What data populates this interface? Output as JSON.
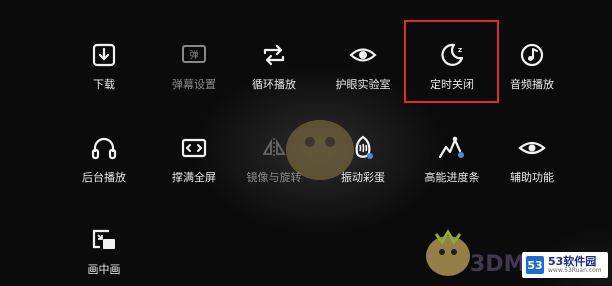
{
  "menu": {
    "items": [
      {
        "label": "下载",
        "icon": "download-icon",
        "disabled": false
      },
      {
        "label": "弹幕设置",
        "icon": "danmaku-settings-icon",
        "disabled": true
      },
      {
        "label": "循环播放",
        "icon": "loop-icon",
        "disabled": false
      },
      {
        "label": "护眼实验室",
        "icon": "eye-care-icon",
        "disabled": false
      },
      {
        "label": "定时关闭",
        "icon": "sleep-timer-icon",
        "disabled": false
      },
      {
        "label": "音频播放",
        "icon": "audio-disc-icon",
        "disabled": false
      },
      {
        "label": "后台播放",
        "icon": "headphones-icon",
        "disabled": false
      },
      {
        "label": "撑满全屏",
        "icon": "fill-screen-icon",
        "disabled": false
      },
      {
        "label": "镜像与旋转",
        "icon": "mirror-rotate-icon",
        "disabled": true
      },
      {
        "label": "振动彩蛋",
        "icon": "vibration-icon",
        "disabled": false
      },
      {
        "label": "高能进度条",
        "icon": "energy-progress-icon",
        "disabled": false
      },
      {
        "label": "辅助功能",
        "icon": "accessibility-eye-icon",
        "disabled": false
      },
      {
        "label": "画中画",
        "icon": "picture-in-picture-icon",
        "disabled": false
      }
    ]
  },
  "watermark": {
    "text": "3DM"
  },
  "site_logo": {
    "mark": "53",
    "name": "53软件园",
    "sub": "www.53Ruan.com"
  },
  "colors": {
    "highlight": "#e02b2b",
    "background": "#0b0b0c"
  }
}
